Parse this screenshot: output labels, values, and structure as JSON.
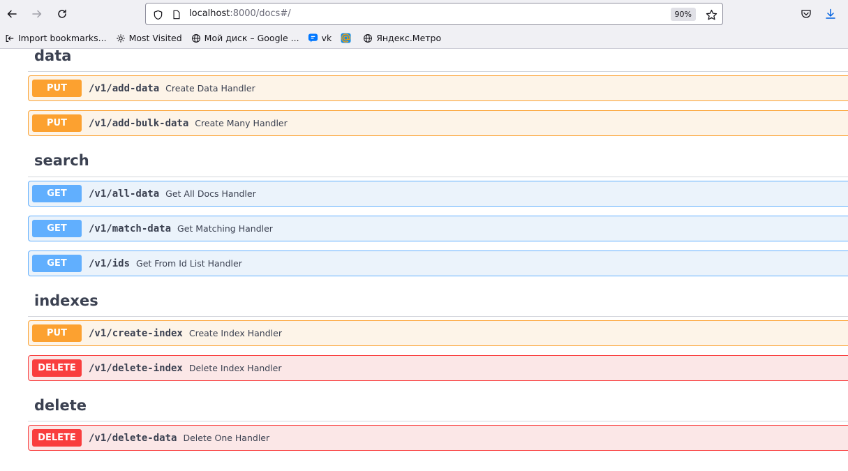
{
  "browser": {
    "url_host": "localhost",
    "url_rest": ":8000/docs#/",
    "zoom": "90%"
  },
  "bookmarks": [
    {
      "label": "Import bookmarks...",
      "icon": "import-icon"
    },
    {
      "label": "Most Visited",
      "icon": "gear-icon"
    },
    {
      "label": "Мой диск – Google ...",
      "icon": "globe-icon"
    },
    {
      "label": "vk",
      "icon": "chat-icon"
    },
    {
      "label": "",
      "icon": "mail-icon"
    },
    {
      "label": "Яндекс.Метро",
      "icon": "globe-icon"
    }
  ],
  "sections": [
    {
      "title": "data",
      "operations": [
        {
          "method": "PUT",
          "path": "/v1/add-data",
          "summary": "Create Data Handler"
        },
        {
          "method": "PUT",
          "path": "/v1/add-bulk-data",
          "summary": "Create Many Handler"
        }
      ]
    },
    {
      "title": "search",
      "operations": [
        {
          "method": "GET",
          "path": "/v1/all-data",
          "summary": "Get All Docs Handler"
        },
        {
          "method": "GET",
          "path": "/v1/match-data",
          "summary": "Get Matching Handler"
        },
        {
          "method": "GET",
          "path": "/v1/ids",
          "summary": "Get From Id List Handler"
        }
      ]
    },
    {
      "title": "indexes",
      "operations": [
        {
          "method": "PUT",
          "path": "/v1/create-index",
          "summary": "Create Index Handler"
        },
        {
          "method": "DELETE",
          "path": "/v1/delete-index",
          "summary": "Delete Index Handler"
        }
      ]
    },
    {
      "title": "delete",
      "operations": [
        {
          "method": "DELETE",
          "path": "/v1/delete-data",
          "summary": "Delete One Handler"
        }
      ]
    }
  ],
  "colors": {
    "put": "#fca130",
    "get": "#61affe",
    "delete": "#f93e3e",
    "text": "#3b4151"
  }
}
